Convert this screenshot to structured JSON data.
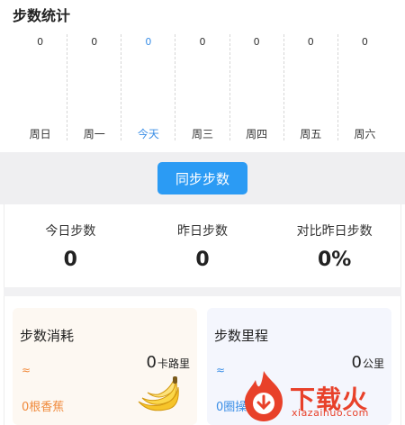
{
  "title": "步数统计",
  "week": [
    {
      "label": "周日",
      "value": "0",
      "today": false
    },
    {
      "label": "周一",
      "value": "0",
      "today": false
    },
    {
      "label": "今天",
      "value": "0",
      "today": true
    },
    {
      "label": "周三",
      "value": "0",
      "today": false
    },
    {
      "label": "周四",
      "value": "0",
      "today": false
    },
    {
      "label": "周五",
      "value": "0",
      "today": false
    },
    {
      "label": "周六",
      "value": "0",
      "today": false
    }
  ],
  "sync_button": "同步步数",
  "summary": {
    "today": {
      "label": "今日步数",
      "value": "0"
    },
    "yesterday": {
      "label": "昨日步数",
      "value": "0"
    },
    "compare": {
      "label": "对比昨日步数",
      "value": "0%"
    }
  },
  "calories_card": {
    "title": "步数消耗",
    "value": "0",
    "unit": "卡路里",
    "approx": "≈",
    "note": "0根香蕉"
  },
  "distance_card": {
    "title": "步数里程",
    "value": "0",
    "unit": "公里",
    "approx": "≈",
    "note": "0圈操"
  },
  "watermark": {
    "text": "下载火",
    "url": "xiazaihuo.com"
  },
  "colors": {
    "accent": "#2b9bf4",
    "today": "#3a8ee6",
    "orange": "#f08a3c",
    "watermark": "#e8412a"
  },
  "icons": {
    "banana": "banana-icon",
    "logo": "flame-logo-icon"
  }
}
